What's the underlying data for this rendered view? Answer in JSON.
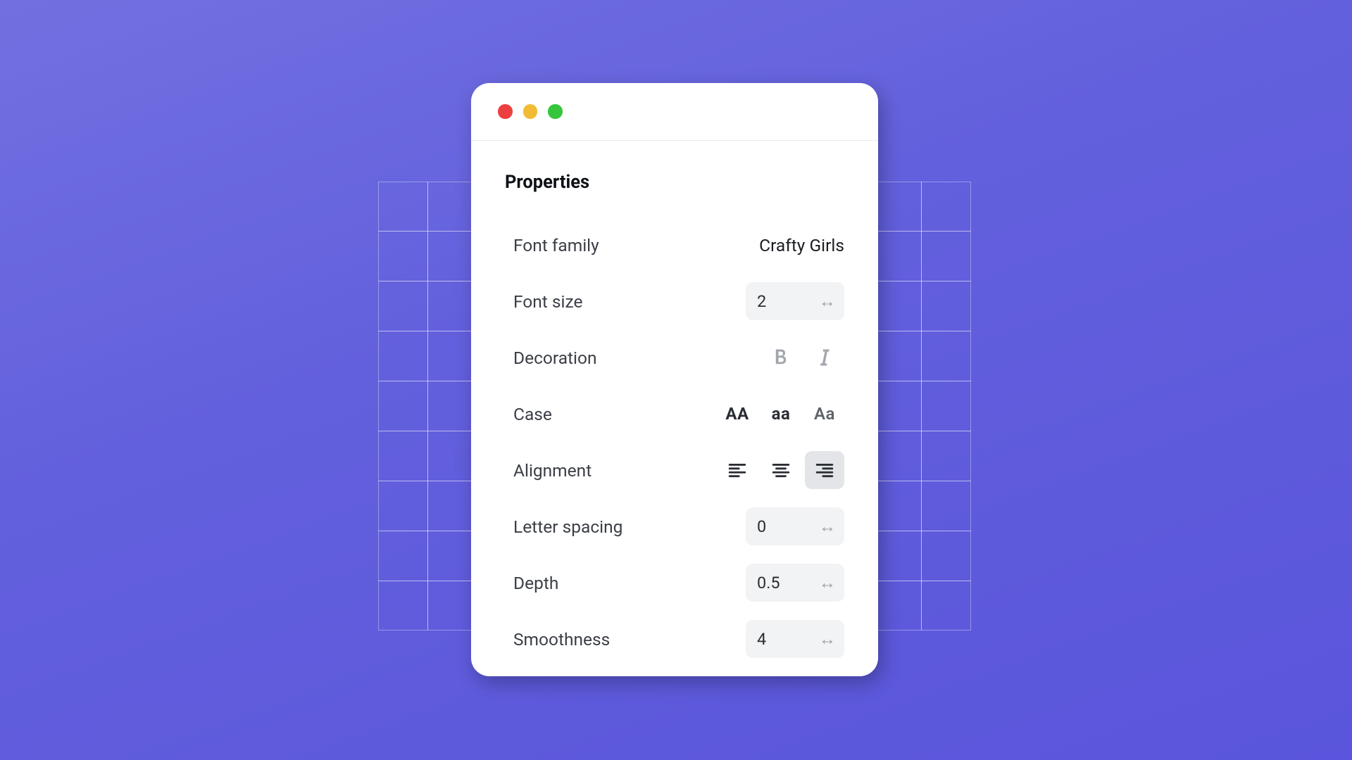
{
  "panel": {
    "title": "Properties",
    "rows": {
      "font_family": {
        "label": "Font family",
        "value": "Crafty Girls"
      },
      "font_size": {
        "label": "Font size",
        "value": "2"
      },
      "decoration": {
        "label": "Decoration"
      },
      "case": {
        "label": "Case",
        "upper": "AA",
        "lower": "aa",
        "mixed": "Aa"
      },
      "alignment": {
        "label": "Alignment"
      },
      "letter_spacing": {
        "label": "Letter spacing",
        "value": "0"
      },
      "depth": {
        "label": "Depth",
        "value": "0.5"
      },
      "smoothness": {
        "label": "Smoothness",
        "value": "4"
      }
    }
  }
}
